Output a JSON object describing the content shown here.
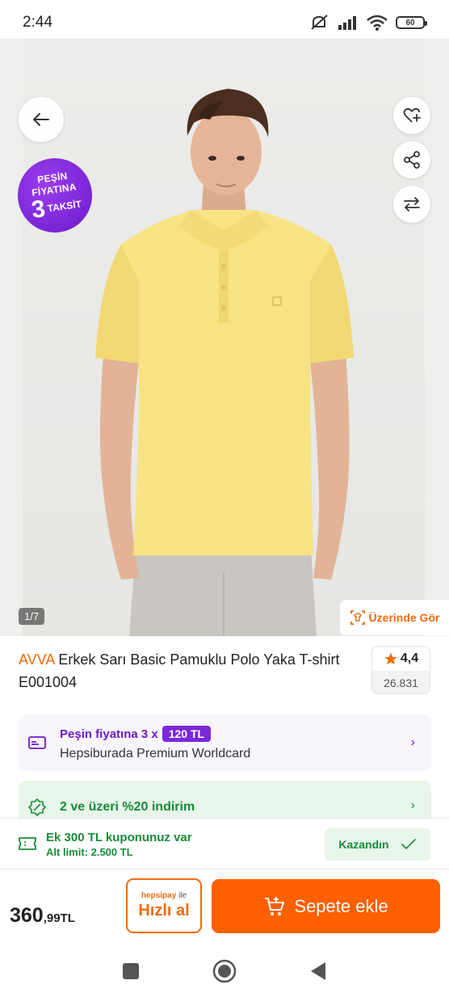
{
  "status_bar": {
    "time": "2:44",
    "battery": "60"
  },
  "gallery": {
    "page_indicator": "1/7",
    "badge": {
      "line1": "PEŞİN",
      "line2": "FİYATINA",
      "number": "3",
      "word": "TAKSİT"
    },
    "try_on_label": "Üzerinde Gör",
    "icons": [
      "back-arrow-icon",
      "heart-plus-icon",
      "share-icon",
      "compare-icon"
    ]
  },
  "product": {
    "brand": "AVVA",
    "title": "Erkek Sarı Basic Pamuklu Polo Yaka T-shirt E001004",
    "rating": "4,4",
    "review_count": "26.831"
  },
  "installment_card": {
    "prefix": "Peşin fiyatına 3 x",
    "amount": "120 TL",
    "card_name": "Hepsiburada Premium Worldcard"
  },
  "discount_card": {
    "text": "2 ve üzeri %20 indirim"
  },
  "coupon": {
    "title": "Ek 300 TL kuponunuz var",
    "limit": "Alt limit: 2.500 TL",
    "button": "Kazandın"
  },
  "action_bar": {
    "price_int": "360",
    "price_dec": ",99TL",
    "hepsipay_brand": "hepsipay",
    "hepsipay_ile": "ile",
    "quick_buy": "Hızlı al",
    "add_to_cart": "Sepete ekle"
  },
  "colors": {
    "accent_orange": "#ff6000",
    "brand_orange": "#f26a0d",
    "purple": "#6c1bc9",
    "green": "#1a8a3a"
  }
}
